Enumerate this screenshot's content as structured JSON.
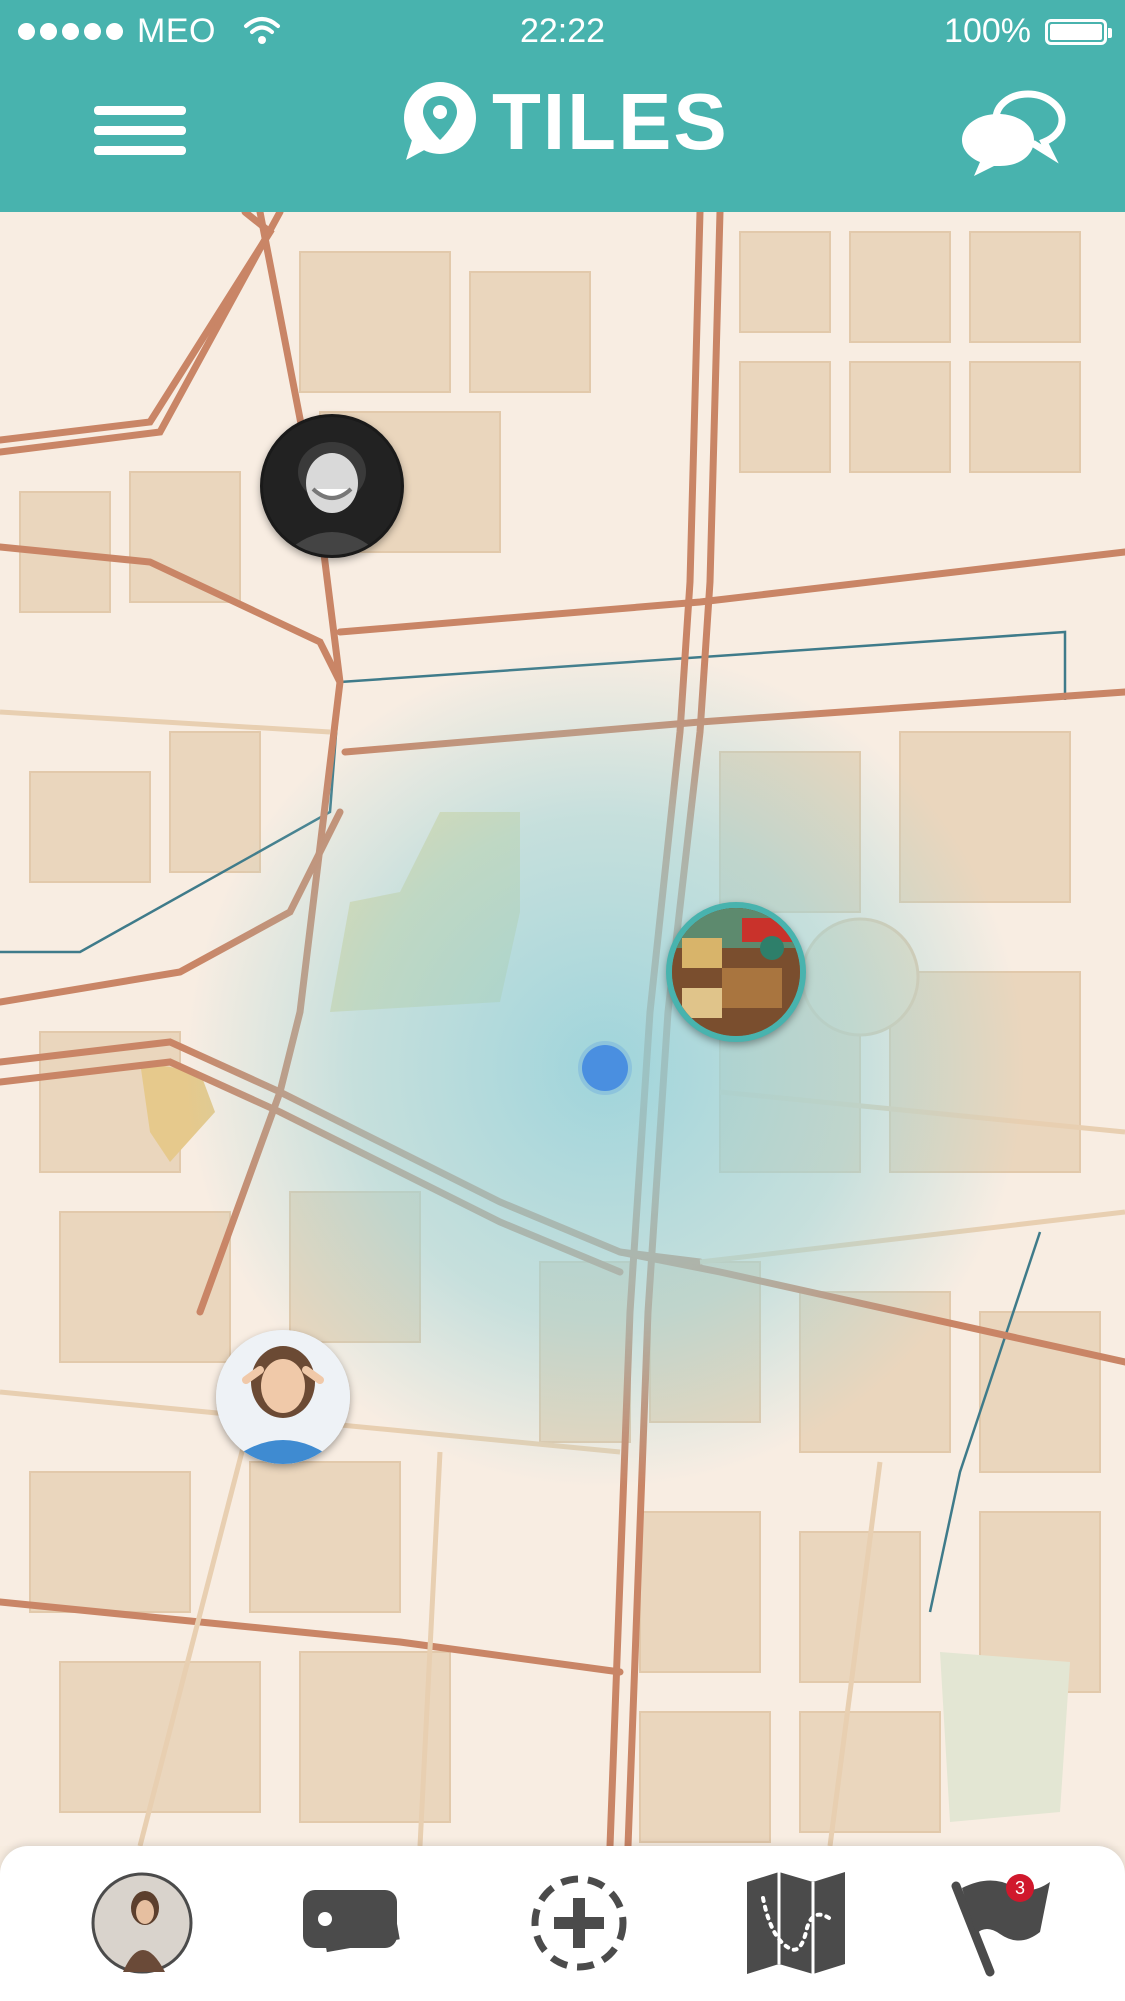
{
  "status_bar": {
    "carrier": "MEO",
    "time": "22:22",
    "battery": "100%"
  },
  "header": {
    "title": "TILES",
    "menu_icon": "hamburger-menu-icon",
    "logo_icon": "location-pin-bubble-icon",
    "chat_icon": "chat-bubbles-icon"
  },
  "map": {
    "pins": [
      {
        "name": "user-pin-man",
        "type": "user"
      },
      {
        "name": "place-pin-circus",
        "type": "place"
      },
      {
        "name": "user-pin-woman",
        "type": "user"
      }
    ],
    "current_location": "current-location-dot"
  },
  "bottom_nav": {
    "items": [
      {
        "icon": "profile-avatar"
      },
      {
        "icon": "tiles-cards-icon"
      },
      {
        "icon": "add-tile-icon"
      },
      {
        "icon": "map-route-icon"
      },
      {
        "icon": "flag-notifications-icon",
        "badge": "3"
      }
    ]
  },
  "colors": {
    "accent": "#48b3ae",
    "road": "#c98566",
    "map_background": "#f7ece0",
    "location_dot": "#4a8fe0",
    "badge": "#d0182c"
  }
}
